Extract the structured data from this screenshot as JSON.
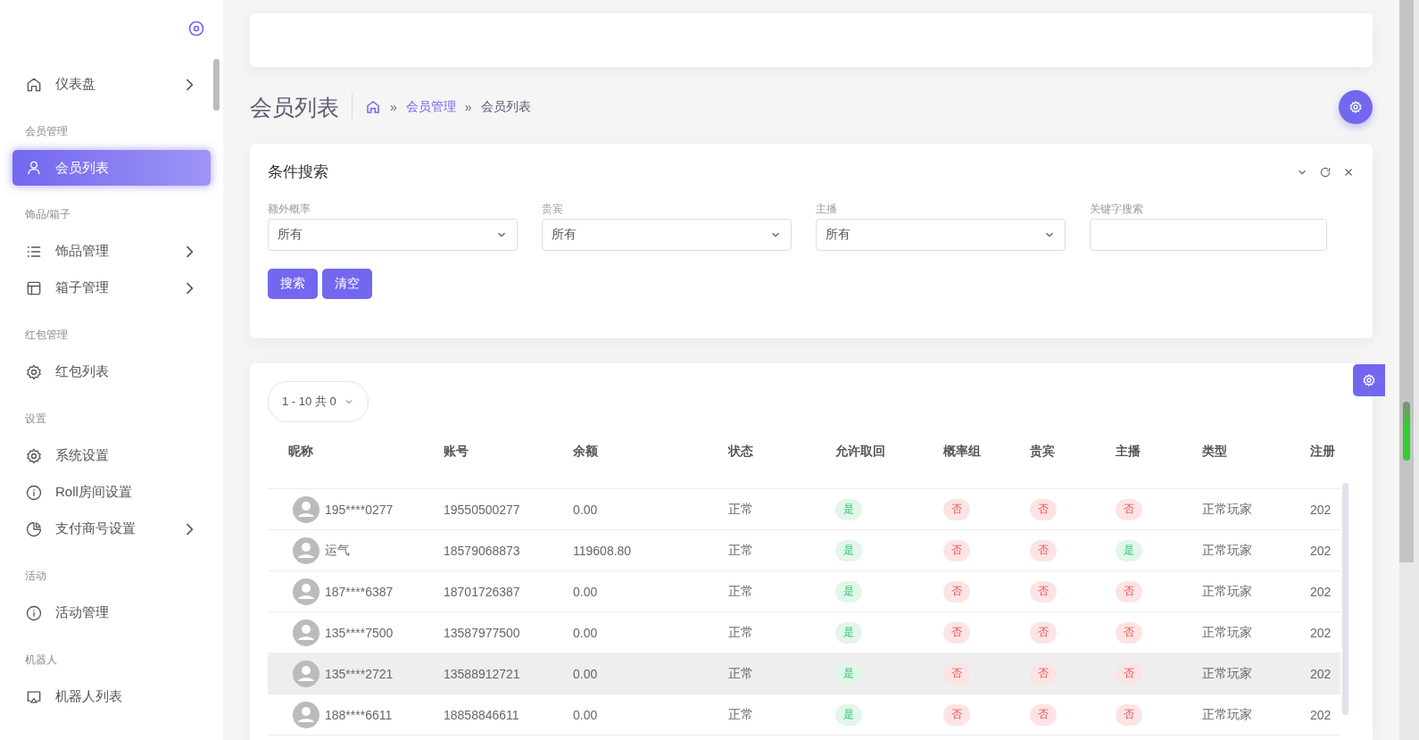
{
  "sidebar": {
    "sections": [
      {
        "items": [
          {
            "label": "仪表盘",
            "has_children": true,
            "selected": false
          }
        ]
      },
      {
        "title": "会员管理",
        "items": [
          {
            "label": "会员列表",
            "has_children": false,
            "selected": true
          }
        ]
      },
      {
        "title": "饰品/箱子",
        "items": [
          {
            "label": "饰品管理",
            "has_children": true,
            "selected": false
          },
          {
            "label": "箱子管理",
            "has_children": true,
            "selected": false
          }
        ]
      },
      {
        "title": "红包管理",
        "items": [
          {
            "label": "红包列表",
            "has_children": false,
            "selected": false
          }
        ]
      },
      {
        "title": "设置",
        "items": [
          {
            "label": "系统设置",
            "has_children": false,
            "selected": false
          },
          {
            "label": "Roll房间设置",
            "has_children": false,
            "selected": false
          },
          {
            "label": "支付商号设置",
            "has_children": true,
            "selected": false
          }
        ]
      },
      {
        "title": "活动",
        "items": [
          {
            "label": "活动管理",
            "has_children": false,
            "selected": false
          }
        ]
      },
      {
        "title": "机器人",
        "items": [
          {
            "label": "机器人列表",
            "has_children": false,
            "selected": false
          }
        ]
      }
    ]
  },
  "page_header": {
    "title": "会员列表",
    "breadcrumb": [
      {
        "label": "会员管理",
        "link": true
      },
      {
        "label": "会员列表",
        "link": false
      }
    ],
    "separator": "»"
  },
  "search_panel": {
    "title": "条件搜索",
    "filters": [
      {
        "kind": "select",
        "label": "额外概率",
        "value": "所有"
      },
      {
        "kind": "select",
        "label": "贵宾",
        "value": "所有"
      },
      {
        "kind": "select",
        "label": "主播",
        "value": "所有"
      },
      {
        "kind": "input",
        "label": "关键字搜索"
      }
    ],
    "buttons": [
      "搜索",
      "清空"
    ]
  },
  "table": {
    "page_size": "1 - 10 共 0",
    "columns": [
      "昵称",
      "账号",
      "余额",
      "状态",
      "允许取回",
      "概率组",
      "贵宾",
      "主播",
      "类型",
      "注册"
    ],
    "rows": [
      {
        "nickname": "195****0277",
        "account": "19550500277",
        "balance": "0.00",
        "status": "正常",
        "flags": [
          {
            "text": "是",
            "positive": true
          },
          {
            "text": "否",
            "positive": false
          },
          {
            "text": "否",
            "positive": false
          },
          {
            "text": "否",
            "positive": false
          }
        ],
        "type": "正常玩家",
        "registered": "202",
        "highlighted": false
      },
      {
        "nickname": "运气",
        "account": "18579068873",
        "balance": "119608.80",
        "status": "正常",
        "flags": [
          {
            "text": "是",
            "positive": true
          },
          {
            "text": "否",
            "positive": false
          },
          {
            "text": "否",
            "positive": false
          },
          {
            "text": "是",
            "positive": true
          }
        ],
        "type": "正常玩家",
        "registered": "202",
        "highlighted": false
      },
      {
        "nickname": "187****6387",
        "account": "18701726387",
        "balance": "0.00",
        "status": "正常",
        "flags": [
          {
            "text": "是",
            "positive": true
          },
          {
            "text": "否",
            "positive": false
          },
          {
            "text": "否",
            "positive": false
          },
          {
            "text": "否",
            "positive": false
          }
        ],
        "type": "正常玩家",
        "registered": "202",
        "highlighted": false
      },
      {
        "nickname": "135****7500",
        "account": "13587977500",
        "balance": "0.00",
        "status": "正常",
        "flags": [
          {
            "text": "是",
            "positive": true
          },
          {
            "text": "否",
            "positive": false
          },
          {
            "text": "否",
            "positive": false
          },
          {
            "text": "否",
            "positive": false
          }
        ],
        "type": "正常玩家",
        "registered": "202",
        "highlighted": false
      },
      {
        "nickname": "135****2721",
        "account": "13588912721",
        "balance": "0.00",
        "status": "正常",
        "flags": [
          {
            "text": "是",
            "positive": true
          },
          {
            "text": "否",
            "positive": false
          },
          {
            "text": "否",
            "positive": false
          },
          {
            "text": "否",
            "positive": false
          }
        ],
        "type": "正常玩家",
        "registered": "202",
        "highlighted": true
      },
      {
        "nickname": "188****6611",
        "account": "18858846611",
        "balance": "0.00",
        "status": "正常",
        "flags": [
          {
            "text": "是",
            "positive": true
          },
          {
            "text": "否",
            "positive": false
          },
          {
            "text": "否",
            "positive": false
          },
          {
            "text": "否",
            "positive": false
          }
        ],
        "type": "正常玩家",
        "registered": "202",
        "highlighted": false
      }
    ]
  }
}
